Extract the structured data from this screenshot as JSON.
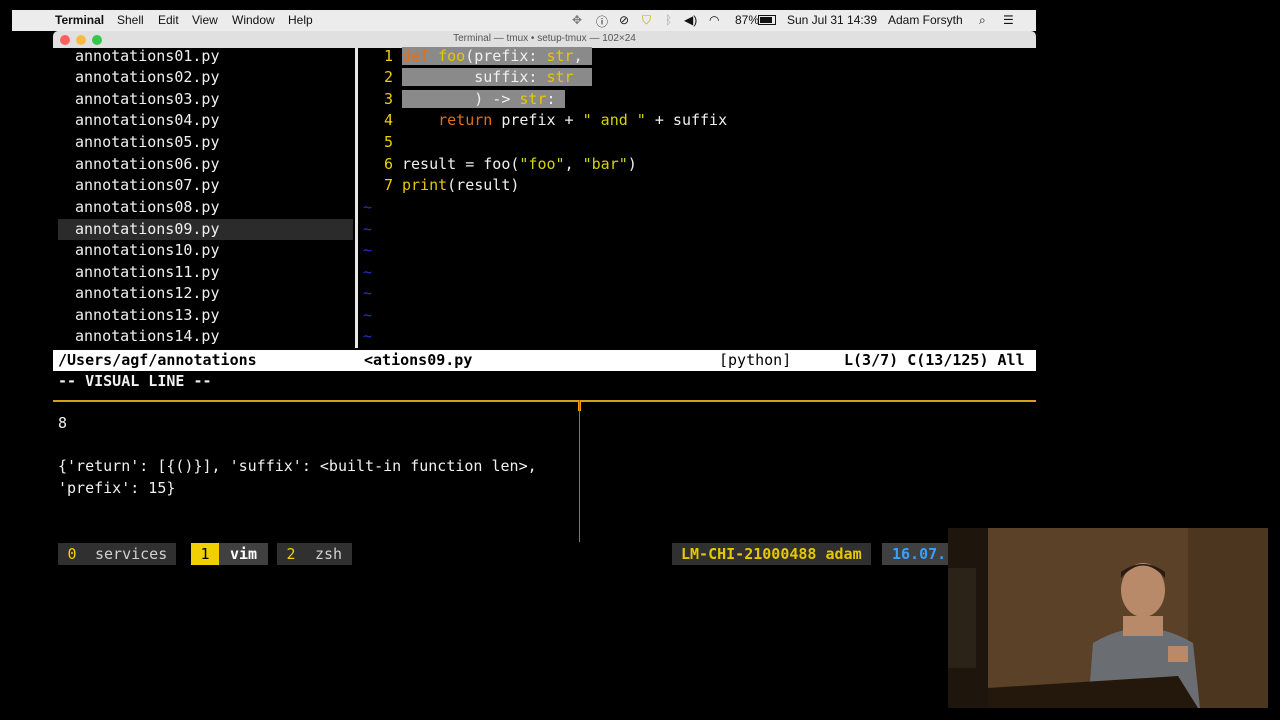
{
  "menubar": {
    "apple": "",
    "app_name": "Terminal",
    "items": [
      "Shell",
      "Edit",
      "View",
      "Window",
      "Help"
    ],
    "battery": "87%",
    "datetime": "Sun Jul 31  14:39",
    "user": "Adam Forsyth"
  },
  "window": {
    "title": "Terminal — tmux • setup-tmux — 102×24"
  },
  "file_tree": {
    "items": [
      "annotations01.py",
      "annotations02.py",
      "annotations03.py",
      "annotations04.py",
      "annotations05.py",
      "annotations06.py",
      "annotations07.py",
      "annotations08.py",
      "annotations09.py",
      "annotations10.py",
      "annotations11.py",
      "annotations12.py",
      "annotations13.py",
      "annotations14.py"
    ],
    "selected_index": 8
  },
  "editor": {
    "line_numbers": [
      "1",
      "2",
      "3",
      "4",
      "5",
      "6",
      "7"
    ],
    "tilde": "~",
    "code": {
      "l1_kw": "def",
      "l1_name": "foo",
      "l1_paren": "(prefix: ",
      "l1_type": "str",
      "l1_end": ",",
      "l2_pre": "        suffix: ",
      "l2_type": "str",
      "l3_pre": "        ) -> ",
      "l3_type": "str",
      "l3_end": ":",
      "l4_ret": "return",
      "l4_a": " prefix + ",
      "l4_str": "\" and \"",
      "l4_b": " + suffix",
      "l6_a": "result = foo(",
      "l6_s1": "\"foo\"",
      "l6_comma": ", ",
      "l6_s2": "\"bar\"",
      "l6_b": ")",
      "l7_fn": "print",
      "l7_rest": "(result)"
    }
  },
  "statusbar": {
    "left_path": "/Users/agf/annotations",
    "file": "<ations09.py",
    "filetype": "[python]",
    "position": "L(3/7) C(13/125) All"
  },
  "mode_line": "-- VISUAL LINE --",
  "output": {
    "line1": "8",
    "line2": "{'return': [{()}], 'suffix': <built-in function len>,",
    "line3": "'prefix': 15}"
  },
  "tmux": {
    "windows": [
      {
        "index": "0",
        "name": "services",
        "active": false
      },
      {
        "index": "1",
        "name": "vim",
        "active": true
      },
      {
        "index": "2",
        "name": "zsh",
        "active": false
      }
    ],
    "host": "LM-CHI-21000488",
    "user": "adam",
    "time": "16.07."
  },
  "colors": {
    "accent_yellow": "#f0d000",
    "keyword_orange": "#e0701a",
    "separator": "#d4a017",
    "tilde_blue": "#2233cc"
  }
}
